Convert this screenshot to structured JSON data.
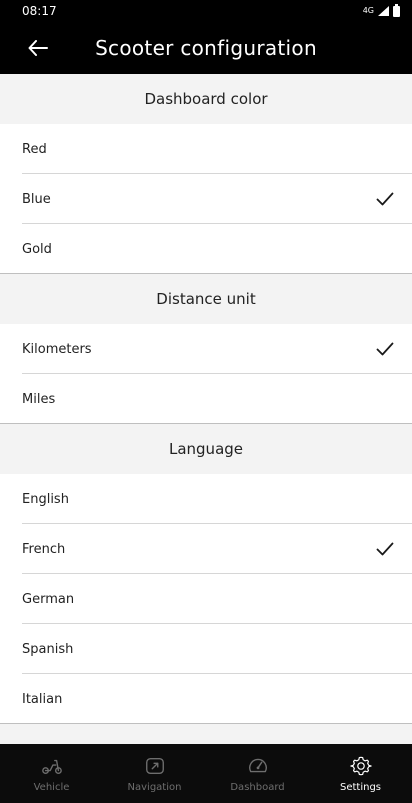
{
  "status_bar": {
    "time": "08:17",
    "network_label": "4G"
  },
  "header": {
    "title": "Scooter configuration"
  },
  "sections": [
    {
      "title": "Dashboard color",
      "options": [
        {
          "label": "Red",
          "selected": false
        },
        {
          "label": "Blue",
          "selected": true
        },
        {
          "label": "Gold",
          "selected": false
        }
      ]
    },
    {
      "title": "Distance unit",
      "options": [
        {
          "label": "Kilometers",
          "selected": true
        },
        {
          "label": "Miles",
          "selected": false
        }
      ]
    },
    {
      "title": "Language",
      "options": [
        {
          "label": "English",
          "selected": false
        },
        {
          "label": "French",
          "selected": true
        },
        {
          "label": "German",
          "selected": false
        },
        {
          "label": "Spanish",
          "selected": false
        },
        {
          "label": "Italian",
          "selected": false
        }
      ]
    }
  ],
  "nav": {
    "items": [
      {
        "label": "Vehicle",
        "icon": "scooter-icon",
        "active": false
      },
      {
        "label": "Navigation",
        "icon": "navigation-icon",
        "active": false
      },
      {
        "label": "Dashboard",
        "icon": "speedometer-icon",
        "active": false
      },
      {
        "label": "Settings",
        "icon": "gear-icon",
        "active": true
      }
    ]
  },
  "colors": {
    "header_bg": "#000000",
    "section_bg": "#f3f3f3",
    "nav_bg": "#0c0c0c",
    "nav_inactive": "#6e6e6e",
    "nav_active": "#ffffff"
  }
}
